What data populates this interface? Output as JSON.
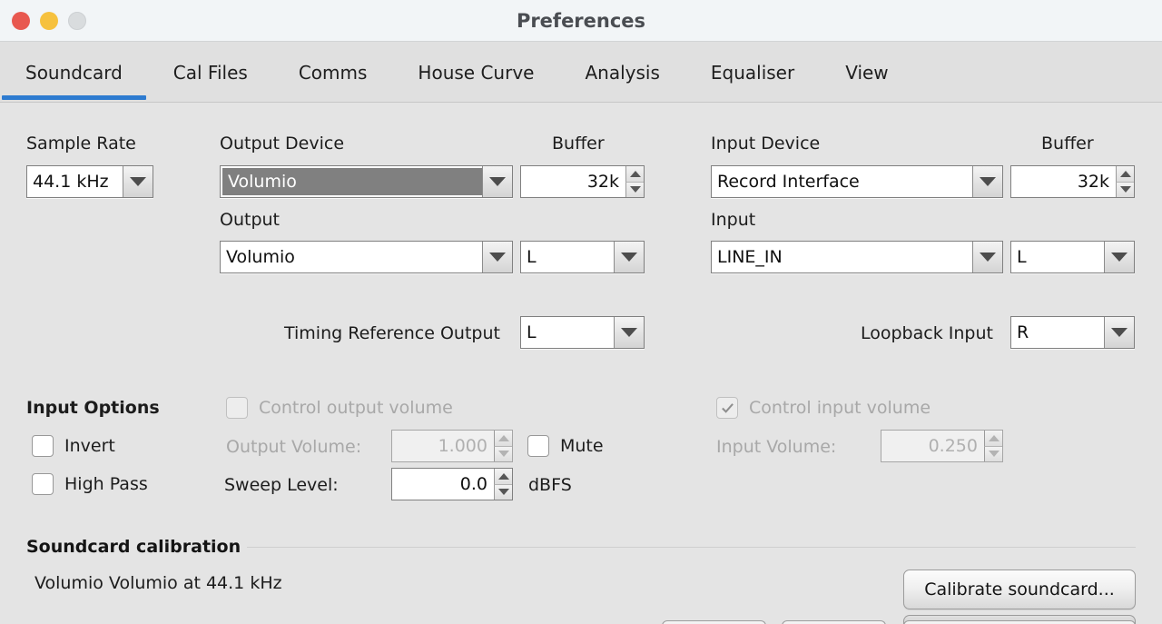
{
  "window": {
    "title": "Preferences",
    "traffic_lights": [
      "close-red",
      "minimize-yellow",
      "zoom-gray-disabled"
    ]
  },
  "tabs": [
    {
      "label": "Soundcard",
      "active": true
    },
    {
      "label": "Cal Files",
      "active": false
    },
    {
      "label": "Comms",
      "active": false
    },
    {
      "label": "House Curve",
      "active": false
    },
    {
      "label": "Analysis",
      "active": false
    },
    {
      "label": "Equaliser",
      "active": false
    },
    {
      "label": "View",
      "active": false
    }
  ],
  "soundcard": {
    "sample_rate": {
      "label": "Sample Rate",
      "value": "44.1 kHz"
    },
    "output_device": {
      "label": "Output Device",
      "value": "Volumio",
      "selected": true
    },
    "output_buffer": {
      "label": "Buffer",
      "value": "32k"
    },
    "output": {
      "label": "Output",
      "value": "Volumio",
      "channel": "L"
    },
    "input_device": {
      "label": "Input Device",
      "value": "Record Interface"
    },
    "input_buffer": {
      "label": "Buffer",
      "value": "32k"
    },
    "input": {
      "label": "Input",
      "value": "LINE_IN",
      "channel": "L"
    },
    "timing_reference_output": {
      "label": "Timing Reference Output",
      "value": "L"
    },
    "loopback_input": {
      "label": "Loopback Input",
      "value": "R"
    }
  },
  "input_options": {
    "title": "Input Options",
    "invert": {
      "label": "Invert",
      "checked": false
    },
    "high_pass": {
      "label": "High Pass",
      "checked": false
    }
  },
  "volume": {
    "control_output_volume": {
      "label": "Control output volume",
      "checked": false,
      "enabled": false
    },
    "output_volume": {
      "label": "Output Volume:",
      "value": "1.000",
      "enabled": false
    },
    "mute": {
      "label": "Mute",
      "checked": false
    },
    "sweep_level": {
      "label": "Sweep Level:",
      "value": "0.0",
      "unit": "dBFS"
    },
    "control_input_volume": {
      "label": "Control input volume",
      "checked": true,
      "enabled": false
    },
    "input_volume": {
      "label": "Input Volume:",
      "value": "0.250",
      "enabled": false
    }
  },
  "calibration": {
    "section_title": "Soundcard calibration",
    "status": "Volumio Volumio at 44.1 kHz",
    "calibrate_button": "Calibrate soundcard..."
  },
  "colors": {
    "accent": "#2d7bd0",
    "window_bg": "#e4e4e4",
    "titlebar_bg": "#f2f5f7",
    "tabbar_bg": "#e0e0e0",
    "selection": "#808080",
    "close": "#e8584f",
    "minimize": "#f6c13e",
    "zoom_disabled": "#d9dcde"
  }
}
